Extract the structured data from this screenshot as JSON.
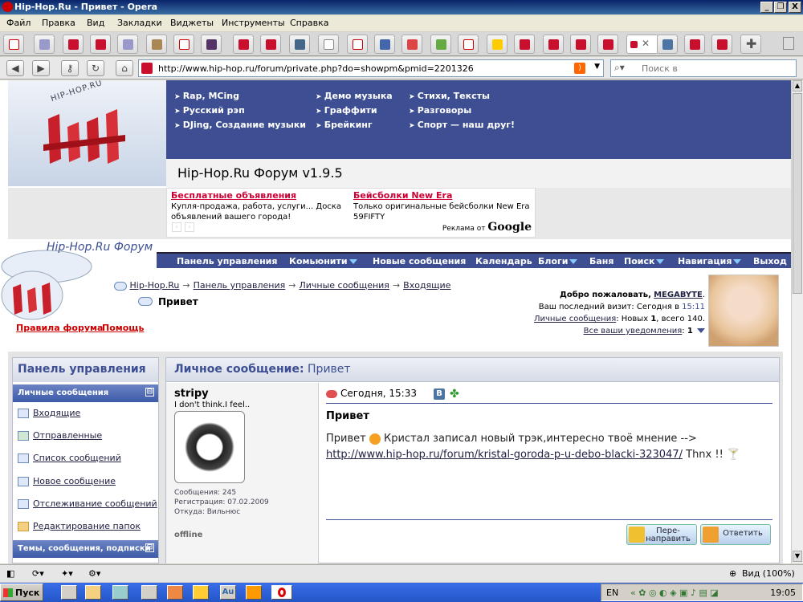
{
  "window": {
    "title": "Hip-Hop.Ru - Привет - Opera",
    "minimize": "_",
    "maximize": "❐",
    "close": "X"
  },
  "menu": [
    "Файл",
    "Правка",
    "Вид",
    "Закладки",
    "Виджеты",
    "Инструменты",
    "Справка"
  ],
  "address": {
    "url": "http://www.hip-hop.ru/forum/private.php?do=showpm&pmid=2201326",
    "search_placeholder": "Поиск в"
  },
  "topnav": {
    "col1": [
      "Rap, MCing",
      "Русский рэп",
      "DJing, Создание музыки"
    ],
    "col2": [
      "Демо музыка",
      "Граффити",
      "Брейкинг"
    ],
    "col3": [
      "Стихи, Тексты",
      "Разговоры",
      "Спорт — наш друг!"
    ]
  },
  "logo_text": "HIP-HOP.RU",
  "forum_title": "Hip-Hop.Ru Форум v1.9.5",
  "ads": [
    {
      "title": "Бесплатные объявления",
      "text": "Купля-продажа, работа, услуги... Доска объявлений вашего города!"
    },
    {
      "title": "Бейсболки New Era",
      "text": "Только оригинальные бейсболки New Era 59FIFTY"
    }
  ],
  "ad_label_prefix": "Реклама от",
  "ad_label_brand": "Google",
  "forum_name": "Hip-Hop.Ru Форум",
  "navbar": [
    "Панель управления",
    "Комьюнити",
    "Новые сообщения",
    "Календарь",
    "Блоги",
    "Баня",
    "Поиск",
    "Навигация",
    "Выход"
  ],
  "breadcrumb": [
    "Hip-Hop.Ru",
    "Панель управления",
    "Личные сообщения",
    "Входящие"
  ],
  "breadcrumb_sep": "→",
  "page_heading": "Привет",
  "links": {
    "rules": "Правила форума",
    "help": "Помощь"
  },
  "welcome": {
    "greeting": "Добро пожаловать,",
    "user": "MEGABYTE",
    "last_visit_label": "Ваш последний визит: Сегодня в",
    "last_visit_time": "15:11",
    "pm_link": "Личные сообщения",
    "pm_text_a": ": Новых",
    "pm_new": "1",
    "pm_text_b": ", всего 140.",
    "notif_link": "Все ваши уведомления",
    "notif_count": "1"
  },
  "sidebar": {
    "title": "Панель управления",
    "section1": "Личные сообщения",
    "items": [
      "Входящие",
      "Отправленные",
      "Список сообщений",
      "Новое сообщение",
      "Отслеживание сообщений",
      "Редактирование папок"
    ],
    "section2": "Темы, сообщения, подписки",
    "collapse": "⊟"
  },
  "message": {
    "header_label": "Личное сообщение",
    "header_sep": ":",
    "header_subject": "Привет",
    "author": "stripy",
    "usertitle": "I don't think.I feel..",
    "posts": "Сообщения: 245",
    "registered": "Регистрация: 07.02.2009",
    "location": "Откуда: Вильнюс",
    "status": "offline",
    "date": "Сегодня, 15:33",
    "subject": "Привет",
    "body_a": "Привет",
    "body_b": "Кристал записал новый трэк,интересно твоё мнение -->",
    "body_link": "http://www.hip-hop.ru/forum/kristal-goroda-p-u-debo-blacki-323047/",
    "body_c": "Thnx !!",
    "forward": "Пере-\nнаправить",
    "reply": "Ответить"
  },
  "statusbar": {
    "zoom": "Вид (100%)"
  },
  "taskbar": {
    "start": "Пуск",
    "lang": "EN",
    "clock": "19:05",
    "tray_au": "Au"
  }
}
